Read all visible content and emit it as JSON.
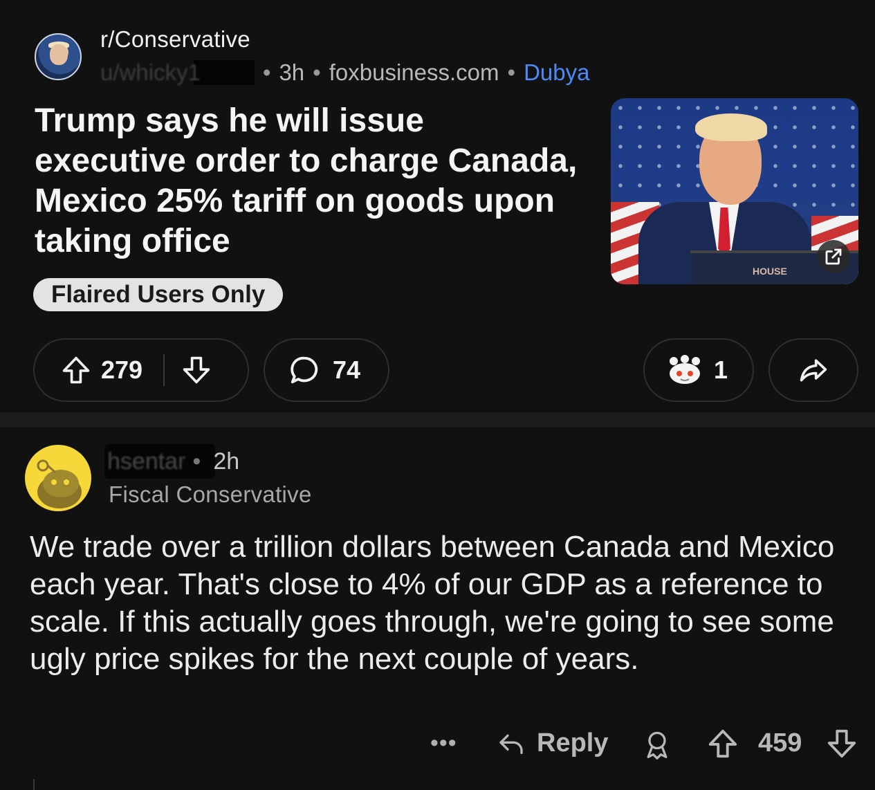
{
  "post": {
    "subreddit": "r/Conservative",
    "author": "u/whicky1",
    "time": "3h",
    "domain": "foxbusiness.com",
    "author_flair": "Dubya",
    "title": "Trump says he will issue executive order to charge Canada, Mexico 25% tariff on goods upon taking office",
    "post_flair": "Flaired Users Only",
    "thumbnail_text": "HOUSE",
    "upvotes": "279",
    "comments": "74",
    "awards": "1"
  },
  "comment": {
    "author": "hsentar",
    "time": "2h",
    "user_flair": "Fiscal Conservative",
    "body": "We trade over a trillion dollars between Canada and Mexico each year. That's close to 4% of our GDP as a reference to scale. If this actually goes through, we're going to see some ugly price spikes for the next couple of years.",
    "more": "•••",
    "reply_label": "Reply",
    "score": "459"
  },
  "colors": {
    "background": "#111111",
    "flair_link": "#4a8bf5",
    "avatar_yellow": "#f6d83a"
  },
  "icons": [
    "upvote-icon",
    "downvote-icon",
    "comment-icon",
    "award-icon",
    "share-icon",
    "external-link-icon",
    "reply-icon",
    "more-icon"
  ]
}
